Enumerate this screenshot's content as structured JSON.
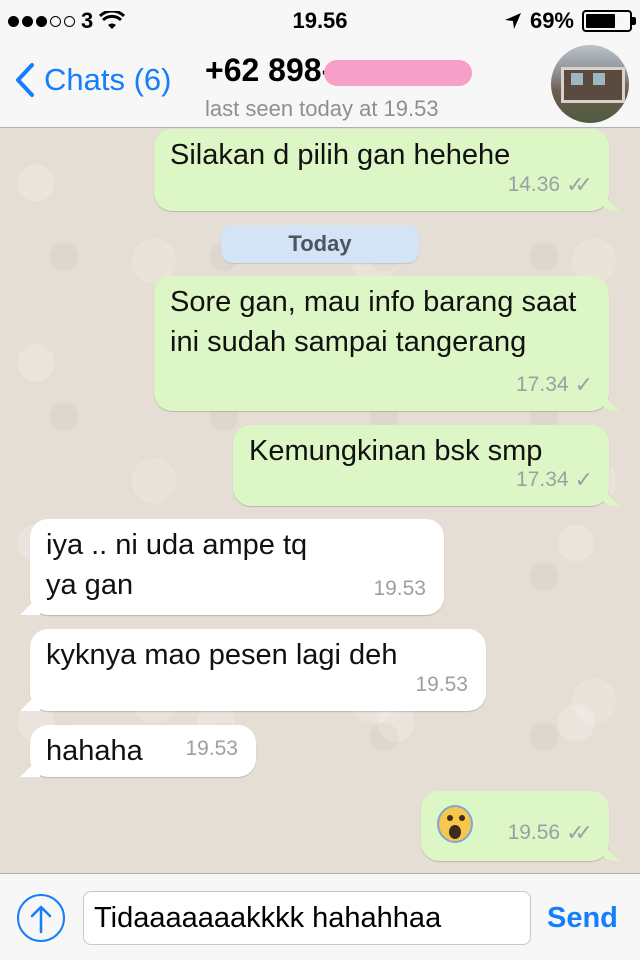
{
  "status_bar": {
    "carrier": "3",
    "time": "19.56",
    "battery": "69%",
    "battery_level": 0.69,
    "signal_bars_filled": 3,
    "signal_bars_total": 5
  },
  "nav": {
    "back_label": "Chats (6)",
    "contact": "+62 898-",
    "last_seen": "last seen today at 19.53"
  },
  "day_separator": "Today",
  "messages": [
    {
      "dir": "out",
      "text": "Silakan d pilih gan hehehe",
      "time": "14.36",
      "ticks": "✓✓"
    },
    {
      "dir": "out",
      "text": "Sore gan, mau info barang saat ini sudah sampai tangerang",
      "time": "17.34",
      "ticks": "✓"
    },
    {
      "dir": "out",
      "text": "Kemungkinan bsk smp",
      "time": "17.34",
      "ticks": "✓"
    },
    {
      "dir": "in",
      "text": "iya .. ni uda ampe tq ya gan",
      "time": "19.53"
    },
    {
      "dir": "in",
      "text": "kyknya mao pesen lagi deh",
      "time": "19.53"
    },
    {
      "dir": "in",
      "text": "hahaha",
      "time": "19.53"
    },
    {
      "dir": "out",
      "text": "",
      "emoji": "screaming-face-emoji",
      "time": "19.56",
      "ticks": "✓✓"
    }
  ],
  "composer": {
    "value": "Tidaaaaaaakkkk hahahhaa",
    "send_label": "Send"
  },
  "colors": {
    "accent": "#157efb",
    "outgoing_bubble": "#dcf7c5",
    "incoming_bubble": "#ffffff",
    "chat_background": "#e5ded4"
  }
}
